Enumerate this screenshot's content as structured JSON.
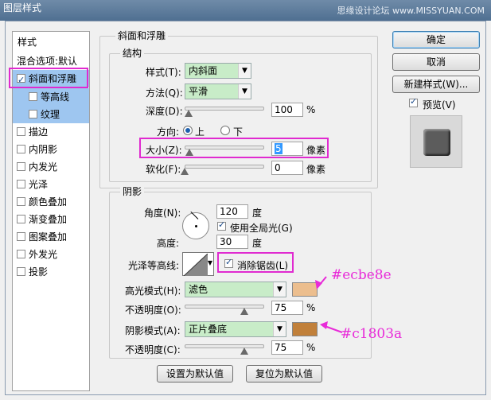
{
  "window": {
    "title": "图层样式",
    "watermark": "思缘设计论坛 www.MISSYUAN.COM"
  },
  "left_list": {
    "header": "样式",
    "items": [
      {
        "label": "混合选项:默认",
        "checkbox": false,
        "checked": false,
        "selected": false
      },
      {
        "label": "斜面和浮雕",
        "checkbox": true,
        "checked": true,
        "selected": true
      },
      {
        "label": "等高线",
        "checkbox": true,
        "checked": false,
        "selected": false,
        "sub": true
      },
      {
        "label": "纹理",
        "checkbox": true,
        "checked": false,
        "selected": false,
        "sub": true
      },
      {
        "label": "描边",
        "checkbox": true,
        "checked": false
      },
      {
        "label": "内阴影",
        "checkbox": true,
        "checked": false
      },
      {
        "label": "内发光",
        "checkbox": true,
        "checked": false
      },
      {
        "label": "光泽",
        "checkbox": true,
        "checked": false
      },
      {
        "label": "颜色叠加",
        "checkbox": true,
        "checked": false
      },
      {
        "label": "渐变叠加",
        "checkbox": true,
        "checked": false
      },
      {
        "label": "图案叠加",
        "checkbox": true,
        "checked": false
      },
      {
        "label": "外发光",
        "checkbox": true,
        "checked": false
      },
      {
        "label": "投影",
        "checkbox": true,
        "checked": false
      }
    ]
  },
  "bevel": {
    "group_title": "斜面和浮雕",
    "structure_title": "结构",
    "style_label": "样式(T):",
    "style_value": "内斜面",
    "method_label": "方法(Q):",
    "method_value": "平滑",
    "depth_label": "深度(D):",
    "depth_value": "100",
    "depth_unit": "%",
    "depth_level": 0.2,
    "direction_label": "方向:",
    "direction_up": "上",
    "direction_down": "下",
    "size_label": "大小(Z):",
    "size_value": "5",
    "size_unit": "像素",
    "size_level": 0.02,
    "soften_label": "软化(F):",
    "soften_value": "0",
    "soften_unit": "像素",
    "soften_level": 0.0
  },
  "shading": {
    "title": "阴影",
    "angle_label": "角度(N):",
    "angle_value": "120",
    "angle_unit": "度",
    "global_light_label": "使用全局光(G)",
    "altitude_label": "高度:",
    "altitude_value": "30",
    "altitude_unit": "度",
    "gloss_label": "光泽等高线:",
    "antialias_label": "消除锯齿(L)",
    "highlight_mode_label": "高光模式(H):",
    "highlight_mode_value": "滤色",
    "highlight_color": "#ecbe8e",
    "highlight_opacity_label": "不透明度(O):",
    "highlight_opacity_value": "75",
    "highlight_opacity_unit": "%",
    "highlight_opacity_level": 0.75,
    "shadow_mode_label": "阴影模式(A):",
    "shadow_mode_value": "正片叠底",
    "shadow_color": "#c1803a",
    "shadow_opacity_label": "不透明度(C):",
    "shadow_opacity_value": "75",
    "shadow_opacity_unit": "%",
    "shadow_opacity_level": 0.75
  },
  "buttons": {
    "ok": "确定",
    "cancel": "取消",
    "new_style": "新建样式(W)...",
    "preview": "预览(V)",
    "make_default": "设置为默认值",
    "reset_default": "复位为默认值"
  },
  "annotations": {
    "highlight_hex": "#ecbe8e",
    "shadow_hex": "#c1803a"
  }
}
